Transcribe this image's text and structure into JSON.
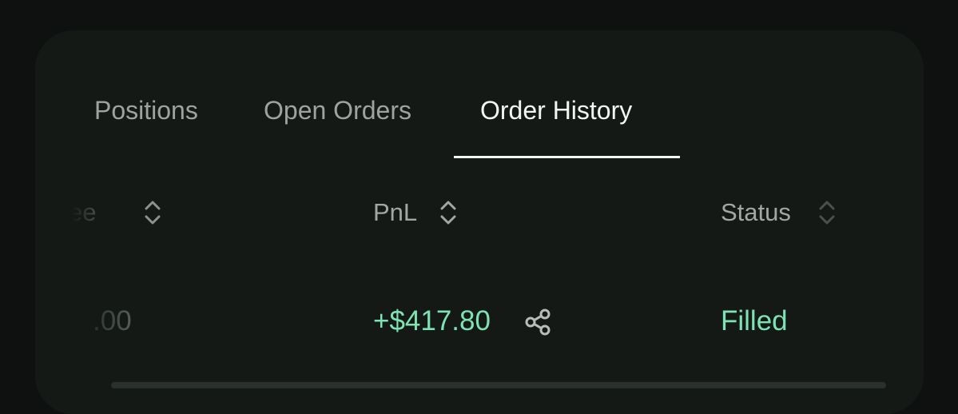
{
  "tabs": {
    "positions": "Positions",
    "open_orders": "Open Orders",
    "order_history": "Order History",
    "active": "order_history"
  },
  "table": {
    "headers": {
      "fee_partial": "ee",
      "pnl": "PnL",
      "status": "Status"
    },
    "row": {
      "fee_partial": ".00",
      "pnl": "+$417.80",
      "status": "Filled"
    }
  },
  "icons": {
    "sort": "sort-updown-icon",
    "share": "share-icon"
  },
  "colors": {
    "background": "#0f1110",
    "card": "#141916",
    "active_tab": "#f3f5f4",
    "inactive_tab": "#9ea3a0",
    "positive": "#7ee3b4"
  }
}
